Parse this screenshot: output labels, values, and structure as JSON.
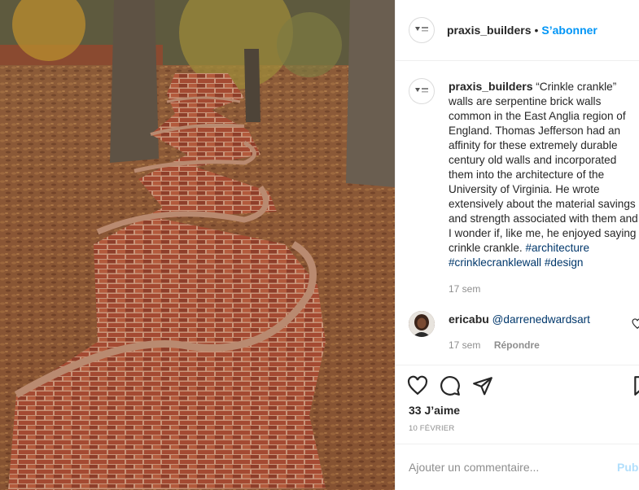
{
  "post": {
    "username": "praxis_builders",
    "separator": "•",
    "follow_label": "S’abonner"
  },
  "caption": {
    "username": "praxis_builders",
    "text": "“Crinkle crankle” walls are serpentine brick walls common in the East Anglia region of England. Thomas Jefferson had an affinity for these extremely durable century old walls and incorporated them into the architecture of the University of Virginia. He wrote extensively about the material savings and strength associated with them and I wonder if, like me, he enjoyed saying crinkle crankle.",
    "hashtags": [
      "#architecture",
      "#crinklecranklewall",
      "#design"
    ],
    "time": "17 sem"
  },
  "comment": {
    "username": "ericabu",
    "text": "@darrenedwardsart",
    "time": "17 sem",
    "reply_label": "Répondre"
  },
  "actions": {
    "icons": [
      "heart-icon",
      "comment-icon",
      "share-icon",
      "bookmark-icon"
    ],
    "likes": "33 J’aime",
    "date": "10 FÉVRIER"
  },
  "add_comment": {
    "placeholder": "Ajouter un commentaire...",
    "publish_label": "Publier"
  },
  "colors": {
    "accent": "#0095f6",
    "hashtag": "#00376b",
    "muted": "#8e8e8e",
    "publish_disabled": "#b2dffc"
  }
}
